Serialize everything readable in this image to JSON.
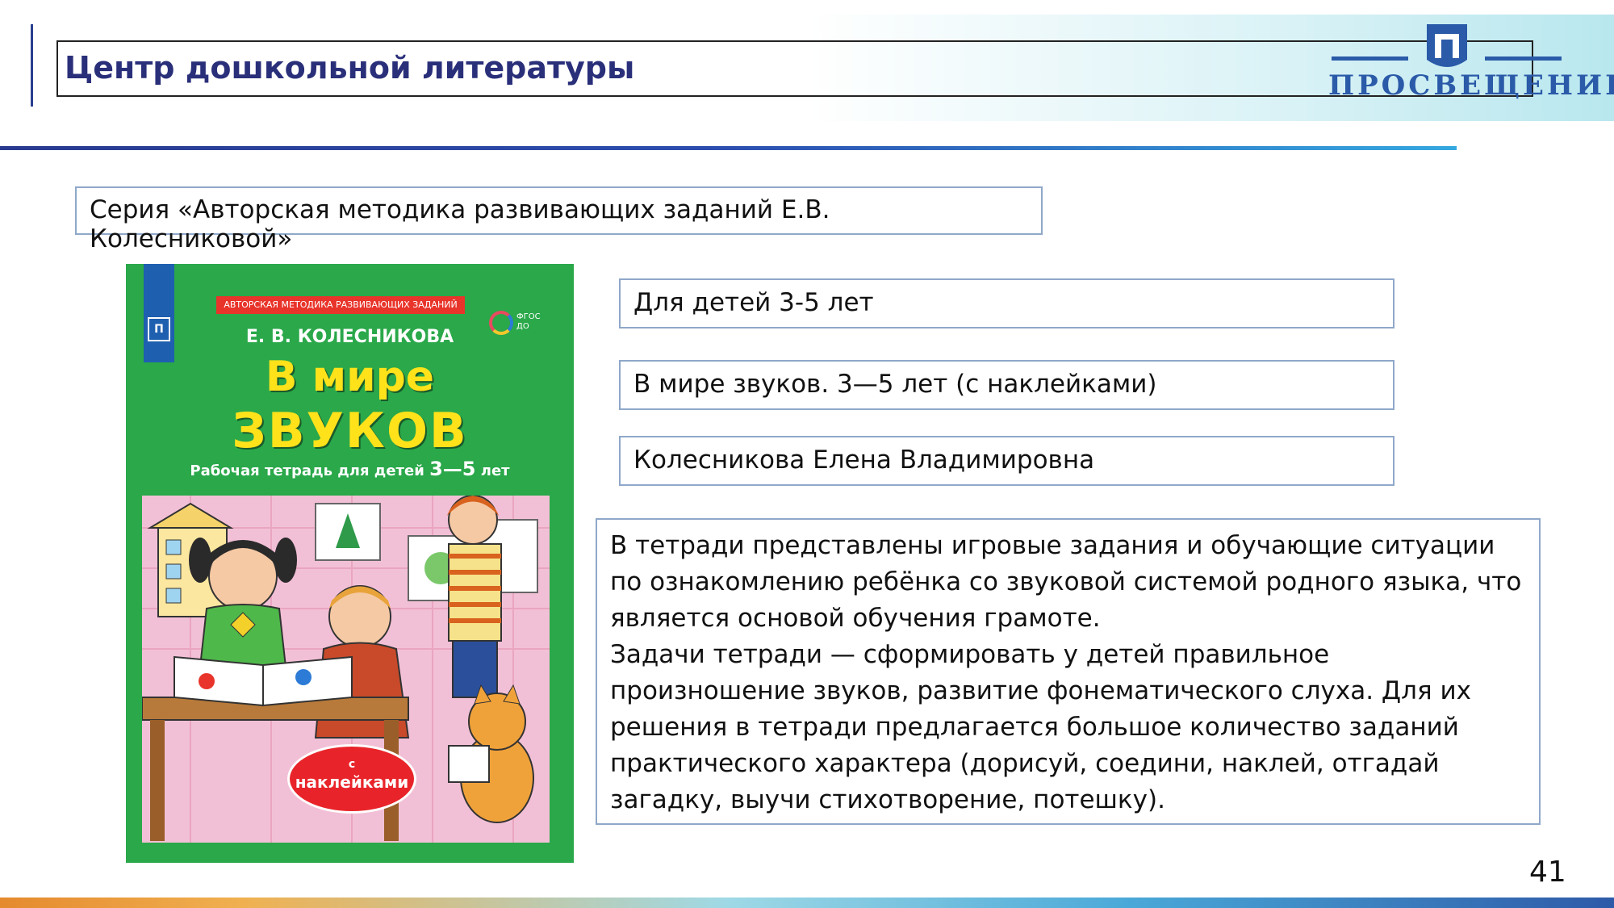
{
  "header": {
    "title": "Центр дошкольной литературы",
    "logo_text": "ПРОСВЕЩЕНИЕ",
    "accent_color": "#2a2f7a"
  },
  "series": "Серия «Авторская методика развивающих заданий Е.В. Колесниковой»",
  "book": {
    "age": "Для детей 3-5 лет",
    "title": "В мире звуков.  3—5 лет (с наклейками)",
    "author": "Колесникова Елена Владимировна",
    "description": [
      "В тетради представлены игровые задания и обучающие ситуации по ознакомлению ребёнка со звуковой системой родного языка, что является основой обучения грамоте.",
      "Задачи тетради — сформировать у детей правильное произношение звуков, развитие фонематического слуха. Для их решения в тетради предлагается большое количество заданий практического характера (дорисуй, соедини, наклей, отгадай загадку, выучи стихотворение, потешку)."
    ]
  },
  "cover": {
    "banner": "АВТОРСКАЯ МЕТОДИКА РАЗВИВАЮЩИХ ЗАДАНИЙ",
    "fgos": "ФГОС ДО",
    "author": "Е. В. КОЛЕСНИКОВА",
    "title_line1": "В мире",
    "title_line2": "ЗВУКОВ",
    "subtitle": "Рабочая тетрадь для детей",
    "subtitle_age": "3—5",
    "subtitle_suffix": "лет",
    "sticker_line1": "с",
    "sticker_line2": "наклейками",
    "background_color": "#2aa84a"
  },
  "page_number": "41"
}
